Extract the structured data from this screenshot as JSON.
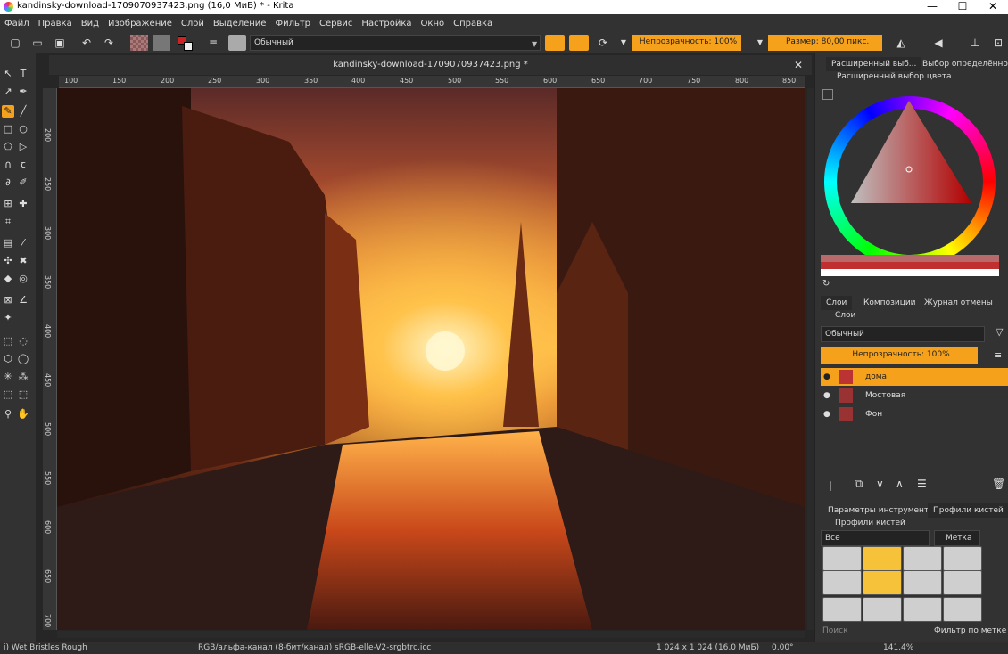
{
  "window": {
    "title": "kandinsky-download-1709070937423.png (16,0 МиБ)  * - Krita",
    "min": "—",
    "max": "☐",
    "close": "✕"
  },
  "menu": [
    "Файл",
    "Правка",
    "Вид",
    "Изображение",
    "Слой",
    "Выделение",
    "Фильтр",
    "Сервис",
    "Настройка",
    "Окно",
    "Справка"
  ],
  "toolbar": {
    "blend_mode": "Обычный",
    "opacity": "Непрозрачность: 100%",
    "size": "Размер: 80,00 пикс."
  },
  "document": {
    "tab_title": "kandinsky-download-1709070937423.png *",
    "close": "✕"
  },
  "ruler": {
    "h": [
      "100",
      "150",
      "200",
      "250",
      "300",
      "350",
      "400",
      "450",
      "500",
      "550",
      "600",
      "650",
      "700",
      "750",
      "800",
      "850"
    ],
    "v": [
      "200",
      "250",
      "300",
      "350",
      "400",
      "450",
      "500",
      "550",
      "600",
      "650",
      "700"
    ]
  },
  "dock": {
    "top_tabs": [
      "Расширенный выб...",
      "Выбор определённо..."
    ],
    "color_panel_title": "Расширенный выбор цвета",
    "layer_tabs": [
      "Слои",
      "Композиции",
      "Журнал отмены"
    ],
    "layers_title": "Слои",
    "layers_blend": "Обычный",
    "layers_opacity": "Непрозрачность:  100%",
    "layers": [
      {
        "name": "дома",
        "active": true
      },
      {
        "name": "Мостовая",
        "active": false
      },
      {
        "name": "Фон",
        "active": false
      }
    ],
    "bottom_tabs": [
      "Параметры инструмента",
      "Профили кистей"
    ],
    "brush_panel_title": "Профили кистей",
    "brush_filter": "Все",
    "brush_tag": "Метка",
    "search_placeholder": "Поиск",
    "filter_by_tag": "Фильтр по метке"
  },
  "status": {
    "brush": "i) Wet Bristles Rough",
    "color": "RGB/альфа-канал (8-бит/канал)  sRGB-elle-V2-srgbtrc.icc",
    "size": "1 024 x 1 024 (16,0 МиБ)",
    "rotation": "0,00°",
    "zoom": "141,4%"
  },
  "colors": {
    "accent": "#f6a11b",
    "panel": "#323232",
    "dark": "#262626"
  }
}
